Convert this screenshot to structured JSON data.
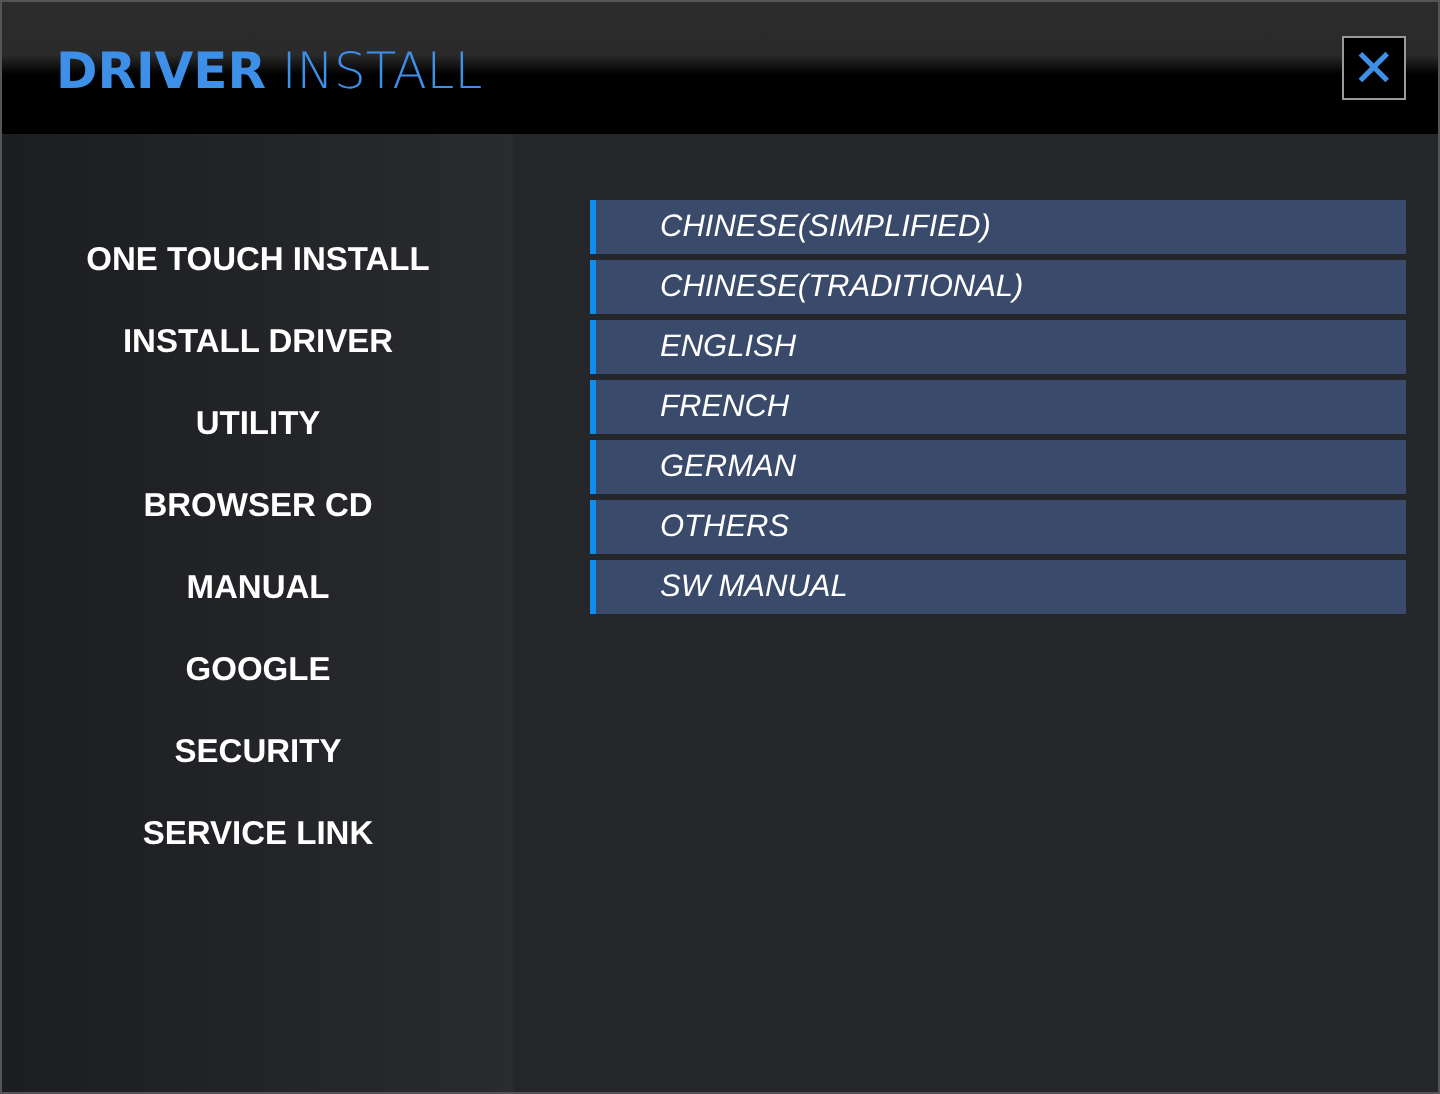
{
  "window": {
    "title": "**DRIVER** INSTALL",
    "close": "✕"
  },
  "sidebar": {
    "items": [
      {
        "label": "ONE TOUCH INSTALL"
      },
      {
        "label": "INSTALL DRIVER"
      },
      {
        "label": "UTILITY"
      },
      {
        "label": "BROWSER CD"
      },
      {
        "label": "MANUAL"
      },
      {
        "label": "GOOGLE"
      },
      {
        "label": "SECURITY"
      },
      {
        "label": "SERVICE LINK"
      }
    ]
  },
  "languages": [
    {
      "label": "CHINESE(SIMPLIFIED)"
    },
    {
      "label": "CHINESE(TRADITIONAL)"
    },
    {
      "label": "ENGLISH"
    },
    {
      "label": "FRENCH"
    },
    {
      "label": "GERMAN"
    },
    {
      "label": "OTHERS"
    },
    {
      "label": "SW MANUAL"
    }
  ]
}
